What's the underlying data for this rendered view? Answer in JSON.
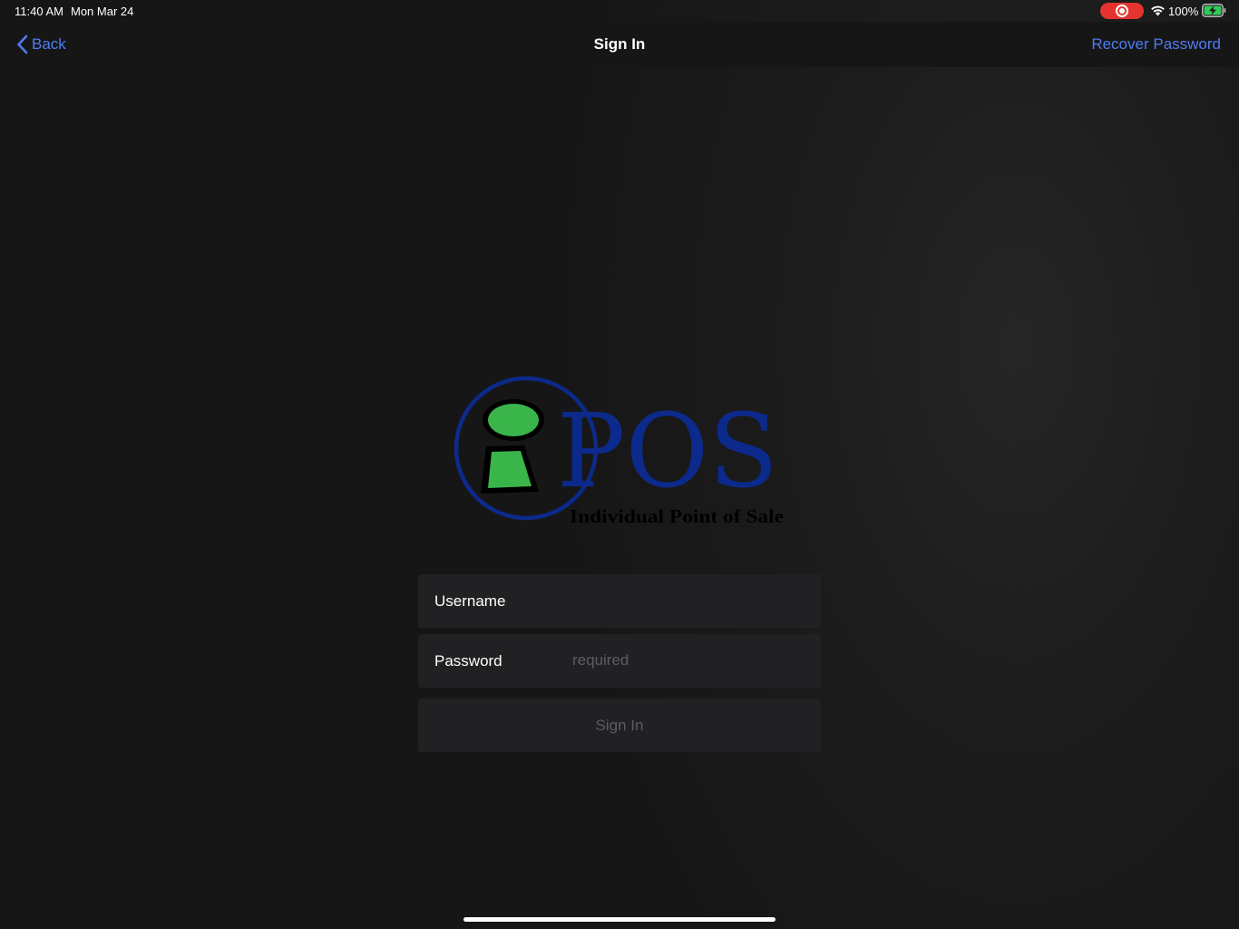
{
  "status_bar": {
    "time": "11:40 AM",
    "date": "Mon Mar 24",
    "battery_percent": "100%",
    "recording_color": "#e5342f",
    "battery_charging_color": "#34c759"
  },
  "nav": {
    "back_label": "Back",
    "title": "Sign In",
    "recover_label": "Recover Password",
    "accent_color": "#4e7cf0"
  },
  "logo": {
    "wordmark": "POS",
    "tagline": "Individual Point of Sale",
    "brand_blue": "#0c2a8c",
    "brand_green": "#3ab54a"
  },
  "form": {
    "username_label": "Username",
    "username_value": "",
    "username_placeholder": "",
    "password_label": "Password",
    "password_value": "",
    "password_placeholder": "required",
    "submit_label": "Sign In"
  }
}
